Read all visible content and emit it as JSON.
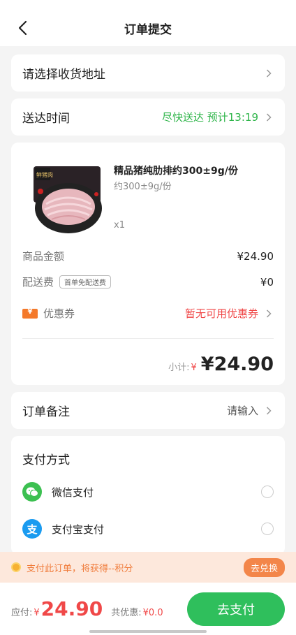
{
  "header": {
    "title": "订单提交"
  },
  "address": {
    "label": "请选择收货地址"
  },
  "delivery": {
    "label": "送达时间",
    "value": "尽快送达 预计13:19"
  },
  "goods": {
    "name": "精品猪纯肋排约300±9g/份",
    "spec": "约300±9g/份",
    "qty": "x1",
    "image_label": "鲜猪肉"
  },
  "fees": {
    "goods_amount_label": "商品金额",
    "goods_amount_value": "¥24.90",
    "shipping_label": "配送费",
    "shipping_tag": "首单免配送费",
    "shipping_value": "¥0",
    "coupon_label": "优惠券",
    "coupon_value": "暂无可用优惠券"
  },
  "subtotal": {
    "label": "小计:",
    "currency": "¥",
    "amount": "¥24.90"
  },
  "remark": {
    "label": "订单备注",
    "value": "请输入"
  },
  "payment": {
    "title": "支付方式",
    "methods": [
      {
        "label": "微信支付",
        "icon": "wechat-pay-icon",
        "color": "#3cc051"
      },
      {
        "label": "支付宝支付",
        "icon": "alipay-icon",
        "color": "#1a9bf0"
      }
    ]
  },
  "points": {
    "text": "支付此订单，将获得--积分",
    "button": "去兑换"
  },
  "footer": {
    "due_label": "应付:",
    "currency": "¥",
    "amount": "24.90",
    "discount_label": "共优惠:",
    "discount_value": "¥0.0",
    "pay_button": "去支付"
  },
  "colors": {
    "accent_green": "#2fbf5c",
    "price_red": "#f04848",
    "points_orange": "#f07b3a"
  }
}
